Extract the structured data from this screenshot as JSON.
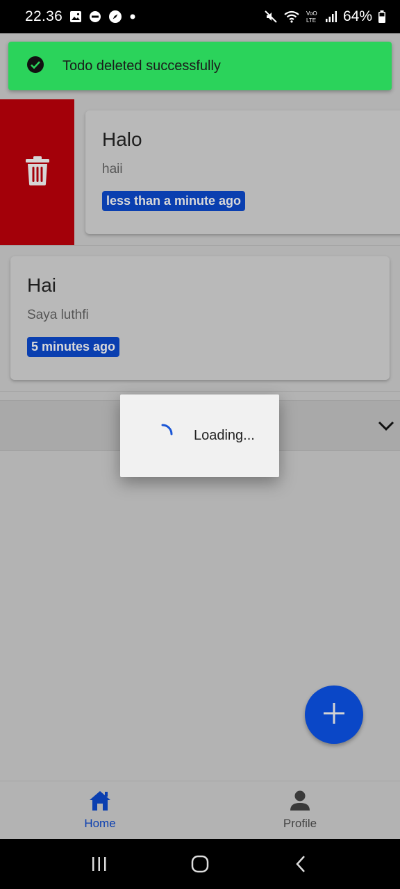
{
  "status_bar": {
    "time": "22.36",
    "battery": "64%",
    "icons": [
      "gallery-icon",
      "dnd-icon",
      "compass-icon",
      "dot-icon",
      "mute-icon",
      "wifi-icon",
      "volte-icon",
      "signal-icon",
      "battery-icon"
    ]
  },
  "toast": {
    "message": "Todo deleted successfully",
    "icon": "check-circle-icon",
    "color": "#2bd35b"
  },
  "todos": [
    {
      "title": "Halo",
      "description": "haii",
      "time": "less than a minute ago",
      "swiping": true
    },
    {
      "title": "Hai",
      "description": "Saya luthfi",
      "time": "5 minutes ago",
      "swiping": false
    }
  ],
  "delete_action": {
    "icon": "trash-icon",
    "color": "#a30009"
  },
  "expansion": {
    "icon": "chevron-down-icon"
  },
  "loading_dialog": {
    "text": "Loading..."
  },
  "fab": {
    "icon": "plus-icon",
    "color": "#0a47c7"
  },
  "bottom_nav": {
    "items": [
      {
        "label": "Home",
        "icon": "home-icon",
        "active": true
      },
      {
        "label": "Profile",
        "icon": "person-icon",
        "active": false
      }
    ]
  },
  "system_nav": {
    "buttons": [
      "recents-icon",
      "home-circle-icon",
      "back-icon"
    ]
  }
}
